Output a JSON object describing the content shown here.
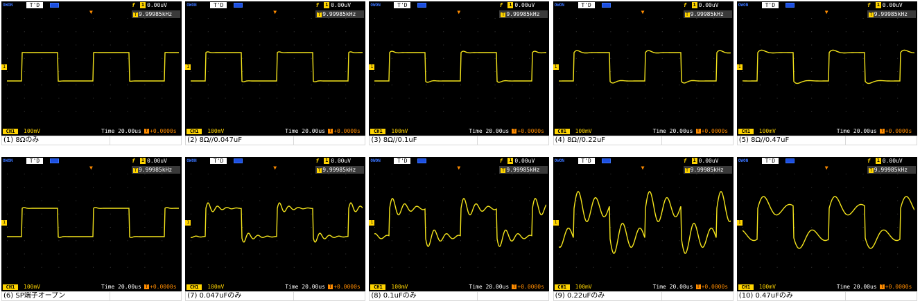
{
  "common": {
    "brand": "OWON",
    "status": "T'D",
    "trigger_icon": "f",
    "trigger_channel": "1",
    "trigger_level": "0.00uV",
    "freq_icon": "T",
    "frequency": "9.99985kHz",
    "channel_marker": "1",
    "channel_badge": "CH1",
    "volts_div": "100mV",
    "time_div": "Time 20.00us",
    "trig_pos_icon": "T",
    "trig_pos": "+0.0000s",
    "trace_color": "#f5e51c",
    "grid_color": "#3c3c3c"
  },
  "panels": [
    {
      "caption": "(1) 8Ωのみ",
      "ring_amp": 0.02,
      "ring_damp": 2.5,
      "ring_freq": 0.18
    },
    {
      "caption": "(2) 8Ω//0.047uF",
      "ring_amp": 0.05,
      "ring_damp": 1.6,
      "ring_freq": 0.2
    },
    {
      "caption": "(3) 8Ω//0.1uF",
      "ring_amp": 0.08,
      "ring_damp": 1.2,
      "ring_freq": 0.16
    },
    {
      "caption": "(4) 8Ω//0.22uF",
      "ring_amp": 0.12,
      "ring_damp": 0.9,
      "ring_freq": 0.12
    },
    {
      "caption": "(5) 8Ω//0.47uF",
      "ring_amp": 0.16,
      "ring_damp": 0.8,
      "ring_freq": 0.09
    },
    {
      "caption": "(6) SP端子オープン",
      "ring_amp": 0.05,
      "ring_damp": 1.6,
      "ring_freq": 0.2
    },
    {
      "caption": "(7) 0.047uFのみ",
      "ring_amp": 0.2,
      "ring_damp": 0.45,
      "ring_freq": 0.22
    },
    {
      "caption": "(8) 0.1uFのみ",
      "ring_amp": 0.35,
      "ring_damp": 0.3,
      "ring_freq": 0.17
    },
    {
      "caption": "(9) 0.22uFのみ",
      "ring_amp": 0.55,
      "ring_damp": 0.12,
      "ring_freq": 0.12
    },
    {
      "caption": "(10) 0.47uFのみ",
      "ring_amp": 0.45,
      "ring_damp": 0.2,
      "ring_freq": 0.08
    }
  ]
}
